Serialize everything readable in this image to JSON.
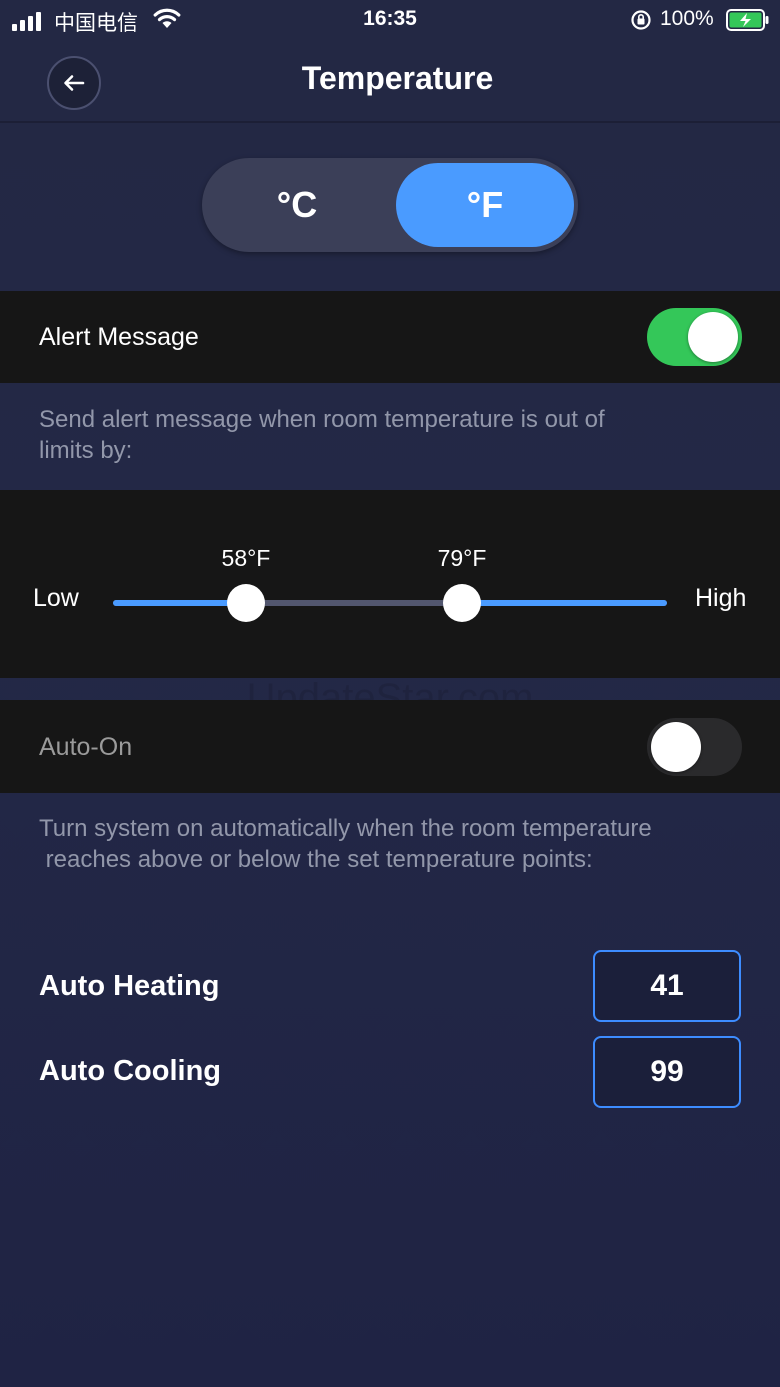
{
  "status_bar": {
    "carrier": "中国电信",
    "time": "16:35",
    "battery": "100%"
  },
  "header": {
    "title": "Temperature",
    "back_icon": "arrow-left-icon"
  },
  "unit_toggle": {
    "celsius_label": "°C",
    "fahrenheit_label": "°F",
    "selected": "°F",
    "accent_color": "#4a9bff"
  },
  "alert": {
    "label": "Alert Message",
    "enabled": true,
    "on_color": "#34c759",
    "description": "Send alert message when room temperature is out of\nlimits by:"
  },
  "range_slider": {
    "low_label": "Low",
    "high_label": "High",
    "low_value_label": "58°F",
    "high_value_label": "79°F",
    "low_fraction": 0.24,
    "high_fraction": 0.63
  },
  "watermark": "UpdateStar.com",
  "auto_on": {
    "label": "Auto-On",
    "enabled": false,
    "description": "Turn system on automatically when the room temperature\n reaches above or below the set temperature points:"
  },
  "auto_heating": {
    "label": "Auto Heating",
    "value": "41"
  },
  "auto_cooling": {
    "label": "Auto Cooling",
    "value": "99"
  }
}
